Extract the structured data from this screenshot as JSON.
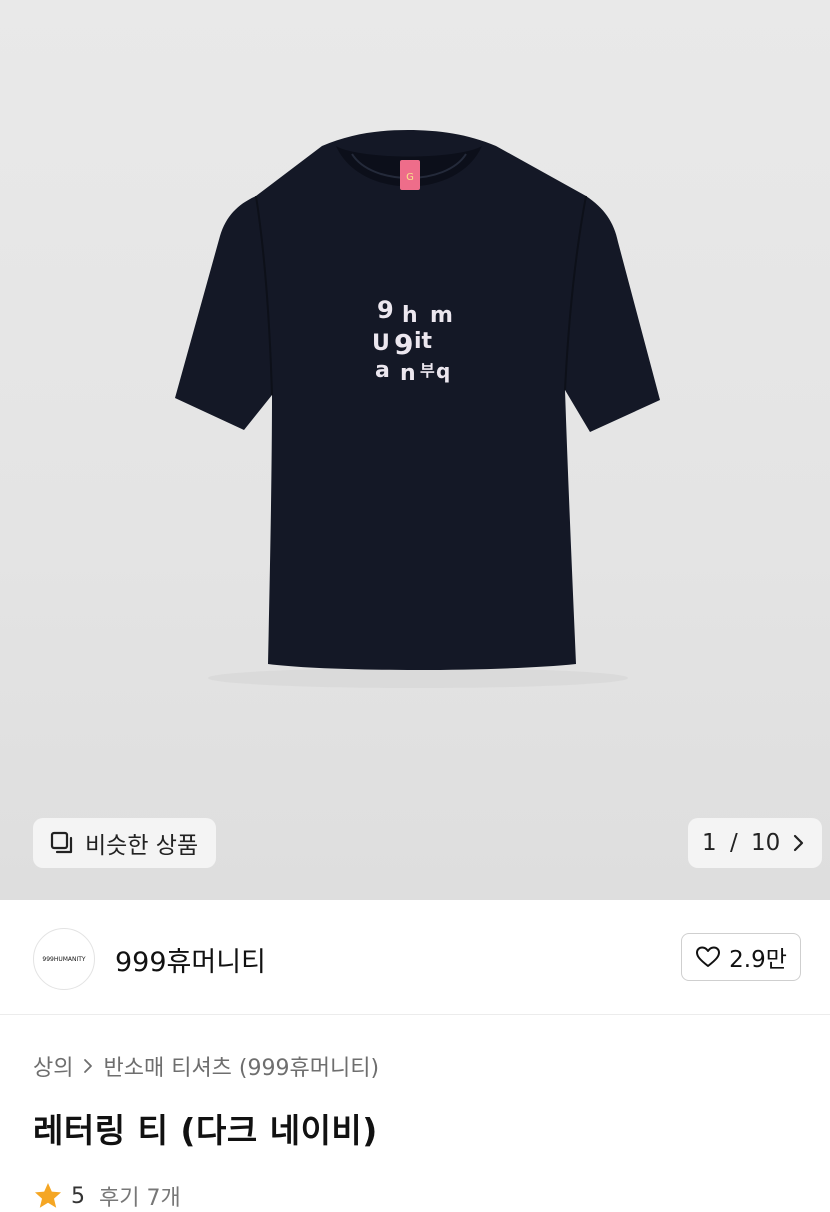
{
  "gallery": {
    "print_text": "9hm u9it an부q",
    "similar_label": "비슷한 상품",
    "current_page": "1",
    "page_separator": "/",
    "total_pages": "10",
    "colors": {
      "background": "#e6e6e6",
      "shirt": "#111522",
      "tag": "#ee6d8a"
    }
  },
  "brand": {
    "logo_text": "999HUMANITY",
    "name": "999휴머니티",
    "like_count": "2.9만"
  },
  "breadcrumb": {
    "items": [
      "상의",
      "반소매 티셔츠 (999휴머니티)"
    ]
  },
  "product": {
    "title": "레터링 티 (다크 네이비)",
    "rating": "5",
    "reviews_label": "후기 7개",
    "star_color": "#f5a623"
  }
}
